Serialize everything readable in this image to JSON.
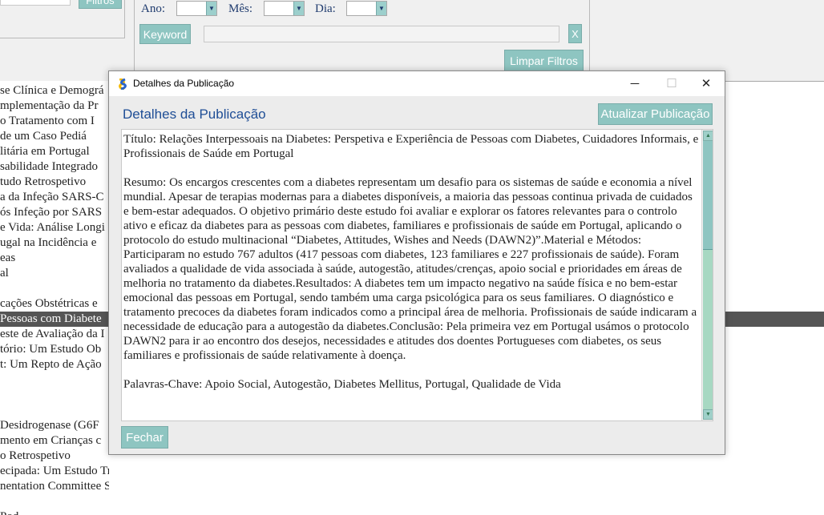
{
  "top_left": {
    "filter_button_label": "Filtros"
  },
  "filters": {
    "ano_label": "Ano:",
    "mes_label": "Mês:",
    "dia_label": "Dia:",
    "keyword_label": "Keyword",
    "keyword_value": "",
    "clear_keyword_label": "X",
    "clear_filters_label": "Limpar Filtros"
  },
  "background_list": [
    {
      "text": "se Clínica e Demográ",
      "selected": false
    },
    {
      "text": "mplementação da Pr",
      "selected": false
    },
    {
      "text": "o Tratamento com I",
      "selected": false
    },
    {
      "text": "de um Caso Pediá",
      "selected": false
    },
    {
      "text": "litária em Portugal",
      "selected": false
    },
    {
      "text": "sabilidade Integrado",
      "selected": false
    },
    {
      "text": "tudo Retrospetivo",
      "selected": false
    },
    {
      "text": "a da Infeção SARS-C",
      "selected": false
    },
    {
      "text": "ós Infeção por SARS",
      "selected": false
    },
    {
      "text": "e Vida: Análise Longi",
      "selected": false
    },
    {
      "text": "ugal na Incidência e",
      "selected": false
    },
    {
      "text": "eas",
      "selected": false
    },
    {
      "text": "al",
      "selected": false
    },
    {
      "text": "",
      "selected": false
    },
    {
      "text": "cações Obstétricas e",
      "selected": false
    },
    {
      "text": "Pessoas com Diabete",
      "selected": true
    },
    {
      "text": "este de Avaliação da I",
      "selected": false
    },
    {
      "text": "tório: Um Estudo Ob",
      "selected": false
    },
    {
      "text": "t: Um Repto de Ação",
      "selected": false
    },
    {
      "text": "",
      "selected": false
    },
    {
      "text": "",
      "selected": false
    },
    {
      "text": "",
      "selected": false
    },
    {
      "text": " Desidrogenase (G6F",
      "selected": false
    },
    {
      "text": "mento em Crianças c",
      "selected": false
    },
    {
      "text": "o Retrospetivo",
      "selected": false
    },
    {
      "text": "ecipada: Um Estudo Transversal",
      "selected": false
    },
    {
      "text": "nentation Committee Score para Português",
      "selected": false
    },
    {
      "text": "",
      "selected": false
    },
    {
      "text": "Pod",
      "selected": false
    }
  ],
  "dialog": {
    "window_title": "Detalhes da Publicação",
    "header_title": "Detalhes da Publicação",
    "update_button_label": "Atualizar Publicação",
    "close_button_label": "Fechar",
    "minimize_glyph": "─",
    "maximize_glyph": "☐",
    "close_glyph": "✕",
    "titulo": "Título: Relações Interpessoais na Diabetes: Perspetiva e Experiência de Pessoas com Diabetes, Cuidadores Informais, e Profissionais de Saúde em Portugal",
    "resumo": "Resumo: Os encargos crescentes com a diabetes representam um desafio para os sistemas de saúde e economia a nível mundial. Apesar de terapias modernas para a diabetes disponíveis, a maioria das pessoas continua privada de cuidados e bem-estar adequados. O objetivo primário deste estudo foi avaliar e explorar os fatores relevantes para o controlo ativo e eficaz da diabetes para as pessoas com diabetes, familiares e profissionais de saúde em Portugal, aplicando o protocolo do estudo multinacional “Diabetes, Attitudes, Wishes and Needs (DAWN2)”.Material e Métodos: Participaram no estudo 767 adultos (417 pessoas com diabetes, 123 familiares e 227 profissionais de saúde). Foram avaliados a qualidade de vida associada à saúde, autogestão, atitudes/crenças, apoio social e prioridades em áreas de melhoria no tratamento da diabetes.Resultados: A diabetes tem um impacto negativo na saúde física e no bem-estar emocional das pessoas em Portugal, sendo também uma carga psicológica para os seus familiares. O diagnóstico e tratamento precoces da diabetes foram indicados como a principal área de melhoria. Profissionais de saúde indicaram a necessidade de educação para a autogestão da diabetes.Conclusão: Pela primeira vez em Portugal usámos o protocolo DAWN2 para ir ao encontro dos desejos, necessidades e atitudes dos doentes Portugueses com diabetes, os seus familiares e profissionais de saúde relativamente à doença.",
    "palavras_chave": "Palavras-Chave: Apoio Social, Autogestão, Diabetes Mellitus, Portugal, Qualidade de Vida",
    "scroll_fraction": 0.0
  },
  "colors": {
    "accent_button": "#8ec5c1",
    "header_text": "#1f4e96",
    "label_text": "#1f3b6e",
    "selected_row": "#555555"
  }
}
